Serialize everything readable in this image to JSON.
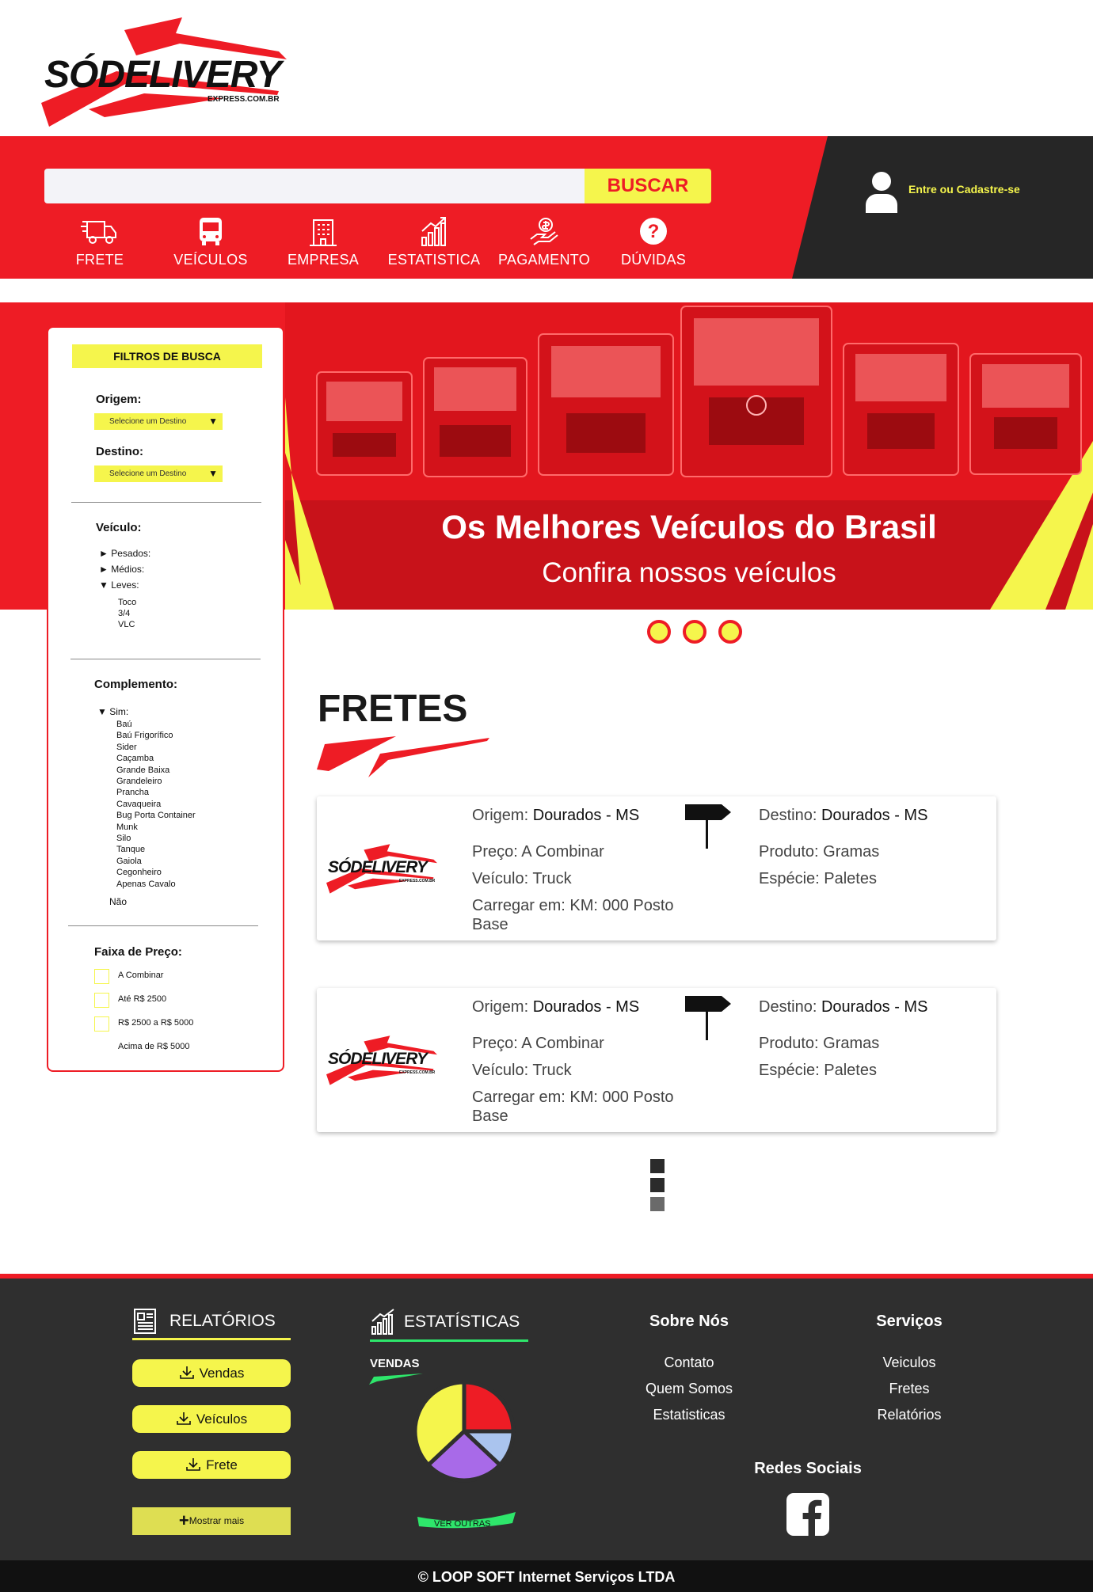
{
  "header": {
    "logo_text": "SÓDELIVERY",
    "logo_sub": "EXPRESS.COM.BR"
  },
  "search": {
    "placeholder": "",
    "button_label": "BUSCAR"
  },
  "nav": {
    "items": [
      {
        "label": "FRETE",
        "icon": "truck-icon"
      },
      {
        "label": "VEÍCULOS",
        "icon": "bus-icon"
      },
      {
        "label": "EMPRESA",
        "icon": "building-icon"
      },
      {
        "label": "ESTATISTICA",
        "icon": "bar-chart-icon"
      },
      {
        "label": "PAGAMENTO",
        "icon": "payment-hand-icon"
      },
      {
        "label": "DÚVIDAS",
        "icon": "question-icon"
      }
    ]
  },
  "login": {
    "label": "Entre ou Cadastre-se",
    "icon": "user-icon"
  },
  "hero": {
    "title": "Os Melhores Veículos do Brasil",
    "subtitle": "Confira nossos veículos",
    "slides": 3
  },
  "filters": {
    "title": "FILTROS DE BUSCA",
    "origem_label": "Origem:",
    "origem_value": "Selecione um Destino",
    "destino_label": "Destino:",
    "destino_value": "Selecione um Destino",
    "veiculo_label": "Veículo:",
    "veiculo_tree": [
      {
        "label": "► Pesados:"
      },
      {
        "label": "► Médios:"
      },
      {
        "label": "▼ Leves:"
      }
    ],
    "leves_items": [
      "Toco",
      "3/4",
      "VLC"
    ],
    "complemento_label": "Complemento:",
    "complemento_sim": "▼ Sim:",
    "complemento_items": [
      "Baú",
      "Baú Frigorífico",
      "Sider",
      "Caçamba",
      "Grande Baixa",
      "Grandeleiro",
      "Prancha",
      "Cavaqueira",
      "Bug Porta Container",
      "Munk",
      "Silo",
      "Tanque",
      "Gaiola",
      "Cegonheiro",
      "Apenas Cavalo"
    ],
    "complemento_nao": "Não",
    "preco_label": "Faixa de Preço:",
    "preco_options": [
      "A Combinar",
      "Até R$ 2500",
      "R$ 2500 a R$ 5000",
      "Acima de R$ 5000"
    ]
  },
  "fretes": {
    "title": "FRETES",
    "cards": [
      {
        "origem_label": "Origem:",
        "origem": "Dourados - MS",
        "destino_label": "Destino:",
        "destino": "Dourados - MS",
        "preco": "Preço: A Combinar",
        "veiculo": "Veículo: Truck",
        "carregar": "Carregar em: KM: 000 Posto Base",
        "produto": "Produto: Gramas",
        "especie": "Espécie: Paletes"
      },
      {
        "origem_label": "Origem:",
        "origem": "Dourados - MS",
        "destino_label": "Destino:",
        "destino": "Dourados - MS",
        "preco": "Preço: A Combinar",
        "veiculo": "Veículo: Truck",
        "carregar": "Carregar em: KM: 000 Posto Base",
        "produto": "Produto: Gramas",
        "especie": "Espécie: Paletes"
      }
    ],
    "pages": 3
  },
  "footer": {
    "relatorios_title": "RELATÓRIOS",
    "relatorios_buttons": [
      "Vendas",
      "Veículos",
      "Frete"
    ],
    "mostrar_mais": "Mostrar mais",
    "estatisticas_title": "ESTATÍSTICAS",
    "vendas_label": "VENDAS",
    "ver_outras": "VER OUTRAS",
    "sobre_title": "Sobre Nós",
    "sobre_links": [
      "Contato",
      "Quem Somos",
      "Estatisticas"
    ],
    "servicos_title": "Serviços",
    "servicos_links": [
      "Veiculos",
      "Fretes",
      "Relatórios"
    ],
    "redes_title": "Redes Sociais",
    "copyright": "© LOOP SOFT Internet Serviços LTDA"
  },
  "colors": {
    "brand_red": "#ee1c25",
    "brand_yellow": "#f5f54c",
    "dark": "#262626",
    "footer_bg": "#2f2f2f",
    "accent_green": "#2ee66b"
  },
  "chart_data": {
    "type": "pie",
    "title": "VENDAS",
    "slices": [
      {
        "color": "#ee1c25",
        "value": 25
      },
      {
        "color": "#aac4ee",
        "value": 12
      },
      {
        "color": "#a86ae8",
        "value": 26
      },
      {
        "color": "#f5f54c",
        "value": 37
      }
    ]
  }
}
